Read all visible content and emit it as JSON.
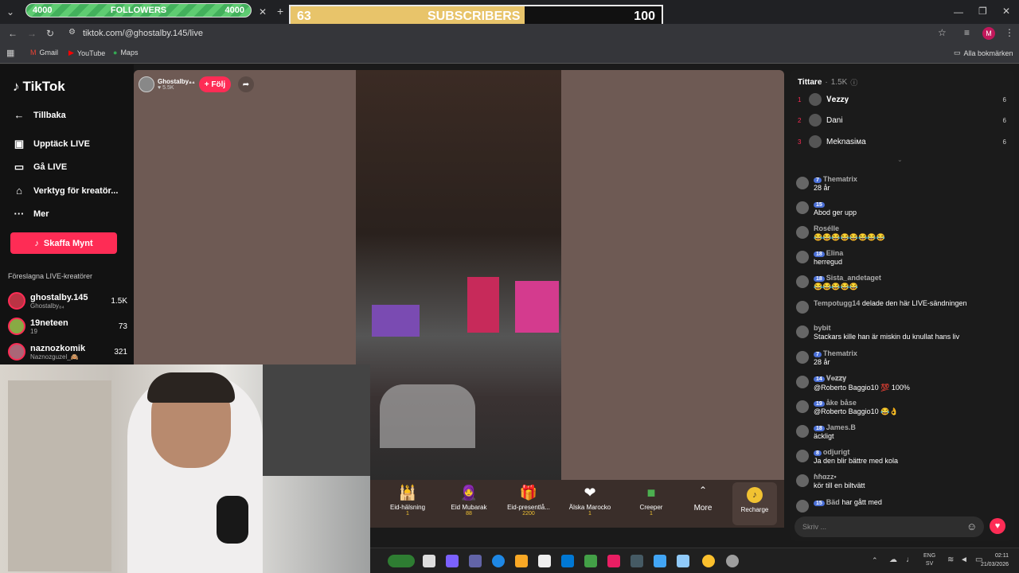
{
  "browser": {
    "followers_goal": {
      "current": "4000",
      "label": "FOLLOWERS",
      "target": "4000"
    },
    "subscribers_goal": {
      "current": "63",
      "label": "SUBSCRIBERS",
      "target": "100",
      "progress": 0.63
    },
    "url": "tiktok.com/@ghostalby.145/live",
    "bookmarks": [
      "Gmail",
      "YouTube",
      "Maps"
    ],
    "all_bookmarks": "Alla bokmärken",
    "profile_initial": "M"
  },
  "sidebar": {
    "brand": "TikTok",
    "back": "Tillbaka",
    "nav": [
      "Upptäck LIVE",
      "Gå LIVE",
      "Verktyg för kreatör...",
      "Mer"
    ],
    "coins_button": "Skaffa Mynt",
    "section_title": "Föreslagna LIVE-kreatörer",
    "creators": [
      {
        "name": "ghostalby.145",
        "sub": "Ghostalby₈₄",
        "count": "1.5K"
      },
      {
        "name": "19neteen",
        "sub": "19",
        "count": "73"
      },
      {
        "name": "naznozkomik",
        "sub": "Naznozguzel_🙈",
        "count": "321"
      }
    ]
  },
  "stream": {
    "streamer_name": "Ghostalby₈₄",
    "streamer_likes": "5.5K",
    "follow_label": "+ Följ",
    "gifts": [
      {
        "name": "Eid-hälsning",
        "cost": "1"
      },
      {
        "name": "Eid Mubarak",
        "cost": "88"
      },
      {
        "name": "Eid-presentlå...",
        "cost": "2200"
      },
      {
        "name": "Älska Marocko",
        "cost": "1"
      },
      {
        "name": "Creeper",
        "cost": "1"
      }
    ],
    "more_label": "More",
    "recharge_label": "Recharge"
  },
  "chat": {
    "viewers_title": "Tittare",
    "viewers_count": "1.5K",
    "top_viewers": [
      {
        "rank": "1",
        "name": "𝐕𝐞𝐳𝐳𝐲",
        "score": "6"
      },
      {
        "rank": "2",
        "name": "Dani",
        "score": "6"
      },
      {
        "rank": "3",
        "name": "Meknasiмa",
        "score": "6"
      }
    ],
    "messages": [
      {
        "badge": "7",
        "user": "Thematrix",
        "text": "28 år"
      },
      {
        "badge": "15",
        "user": "",
        "text": "Abod ger upp"
      },
      {
        "badge": "",
        "user": "Rosélle",
        "text": "😂😂😂😂😂😂😂😂"
      },
      {
        "badge": "18",
        "user": "Elina",
        "text": "herregud"
      },
      {
        "badge": "18",
        "user": "Sista_andetaget",
        "text": "😂😂😂😂😂"
      },
      {
        "badge": "",
        "user": "Tempotugg14",
        "text": "delade den här LIVE-sändningen"
      },
      {
        "badge": "",
        "user": "bybit",
        "text": "Stackars kille han är miskin du knullat hans liv"
      },
      {
        "badge": "7",
        "user": "Thematrix",
        "text": "28 år"
      },
      {
        "badge": "14",
        "user": "𝐕𝐞𝐳𝐳𝐲",
        "text": "@Roberto Baggio10 💯 100%"
      },
      {
        "badge": "19",
        "user": "åke båse",
        "text": "@Roberto Baggio10 😂👌"
      },
      {
        "badge": "18",
        "user": "James.B",
        "text": "äckligt"
      },
      {
        "badge": "8",
        "user": "odjurigt",
        "text": "Ja den blir bättre med kola"
      },
      {
        "badge": "",
        "user": "ɦɦαzz•",
        "text": "kör till en biltvätt"
      },
      {
        "badge": "15",
        "user": "Bäd",
        "text": "har gått med"
      }
    ],
    "input_placeholder": "Skriv ..."
  },
  "taskbar": {
    "lang": "ENG",
    "lang_sub": "SV",
    "time": "02:11",
    "date": "21/03/2026"
  }
}
